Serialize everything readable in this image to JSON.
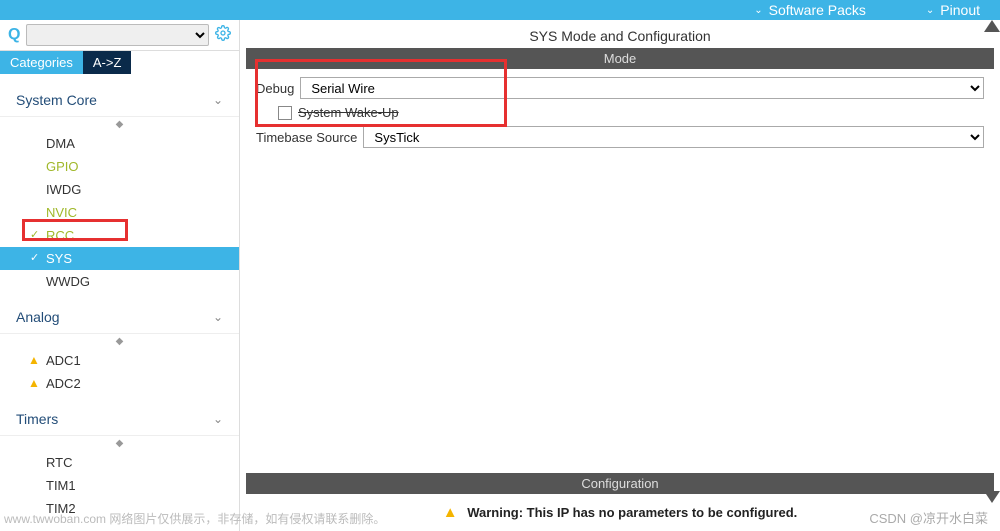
{
  "top_menu": {
    "software_packs": "Software Packs",
    "pinout": "Pinout"
  },
  "search": {
    "placeholder": ""
  },
  "tabs": {
    "categories": "Categories",
    "az": "A->Z"
  },
  "sections": {
    "system_core": {
      "label": "System Core",
      "items": [
        {
          "label": "DMA",
          "style": "normal"
        },
        {
          "label": "GPIO",
          "style": "yellow"
        },
        {
          "label": "IWDG",
          "style": "normal"
        },
        {
          "label": "NVIC",
          "style": "yellow"
        },
        {
          "label": "RCC",
          "style": "yellow",
          "tick": true
        },
        {
          "label": "SYS",
          "style": "selected",
          "tick": true
        },
        {
          "label": "WWDG",
          "style": "normal"
        }
      ]
    },
    "analog": {
      "label": "Analog",
      "items": [
        {
          "label": "ADC1",
          "warn": true
        },
        {
          "label": "ADC2",
          "warn": true
        }
      ]
    },
    "timers": {
      "label": "Timers",
      "items": [
        {
          "label": "RTC"
        },
        {
          "label": "TIM1"
        },
        {
          "label": "TIM2"
        }
      ]
    }
  },
  "right": {
    "title": "SYS Mode and Configuration",
    "mode_label": "Mode",
    "debug_label": "Debug",
    "debug_value": "Serial Wire",
    "wakeup_label": "System Wake-Up",
    "timebase_label": "Timebase Source",
    "timebase_value": "SysTick",
    "config_label": "Configuration",
    "warning": "Warning: This IP has no parameters to be configured."
  },
  "footer": {
    "watermark": "www.twwoban.com  网络图片仅供展示，非存储，如有侵权请联系删除。",
    "csdn": "CSDN @凉开水白菜"
  }
}
